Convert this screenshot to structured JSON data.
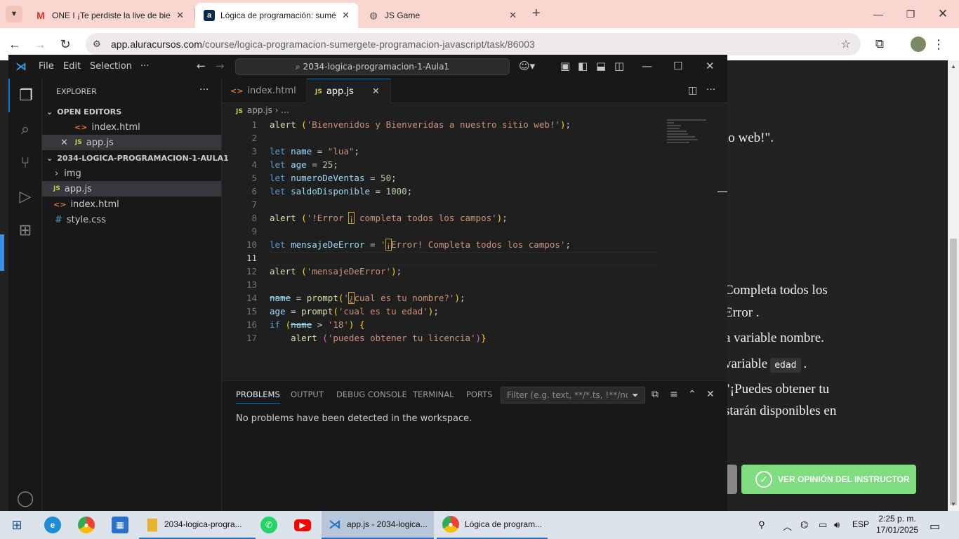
{
  "chrome": {
    "tabs": [
      {
        "title": "ONE I ¡Te perdiste la live de bie",
        "favicon": "gmail-icon"
      },
      {
        "title": "Lógica de programación: sumé",
        "favicon": "alura-icon"
      },
      {
        "title": "JS Game",
        "favicon": "globe-icon"
      }
    ],
    "new_tab": "+",
    "url_host": "app.aluracursos.com",
    "url_path": "/course/logica-programacion-sumergete-programacion-javascript/task/86003"
  },
  "page": {
    "lines": [
      "io web!\".",
      "Completa todos los",
      "Error .",
      "a variable nombre.",
      "variable",
      "edad",
      ".",
      "\"¡Puedes obtener tu",
      "starán disponibles en"
    ],
    "instructor_button": "VER OPINIÓN DEL INSTRUCTOR"
  },
  "vscode": {
    "menu": [
      "File",
      "Edit",
      "Selection",
      "···"
    ],
    "command_center": "2034-logica-programacion-1-Aula1",
    "explorer_title": "EXPLORER",
    "open_editors_label": "OPEN EDITORS",
    "open_editors": [
      "index.html",
      "app.js"
    ],
    "folder_label": "2034-LOGICA-PROGRAMACION-1-AULA1",
    "folder_items": [
      "img",
      "app.js",
      "index.html",
      "style.css"
    ],
    "editor_tabs": [
      "index.html",
      "app.js"
    ],
    "breadcrumb_file": "app.js",
    "breadcrumb_rest": "...",
    "line_numbers": [
      "1",
      "2",
      "3",
      "4",
      "5",
      "6",
      "7",
      "8",
      "9",
      "10",
      "11",
      "12",
      "13",
      "14",
      "15",
      "16",
      "17"
    ],
    "panel_tabs": [
      "PROBLEMS",
      "OUTPUT",
      "DEBUG CONSOLE",
      "TERMINAL",
      "PORTS"
    ],
    "panel_filter_placeholder": "Filter (e.g. text, **/*.ts, !**/node...",
    "panel_message": "No problems have been detected in the workspace."
  },
  "taskbar": {
    "explorer_label": "2034-logica-progra...",
    "vscode_label": "app.js - 2034-logica...",
    "chrome_label": "Lógica de program...",
    "language": "ESP",
    "time": "2:25 p. m.",
    "date": "17/01/2025"
  }
}
